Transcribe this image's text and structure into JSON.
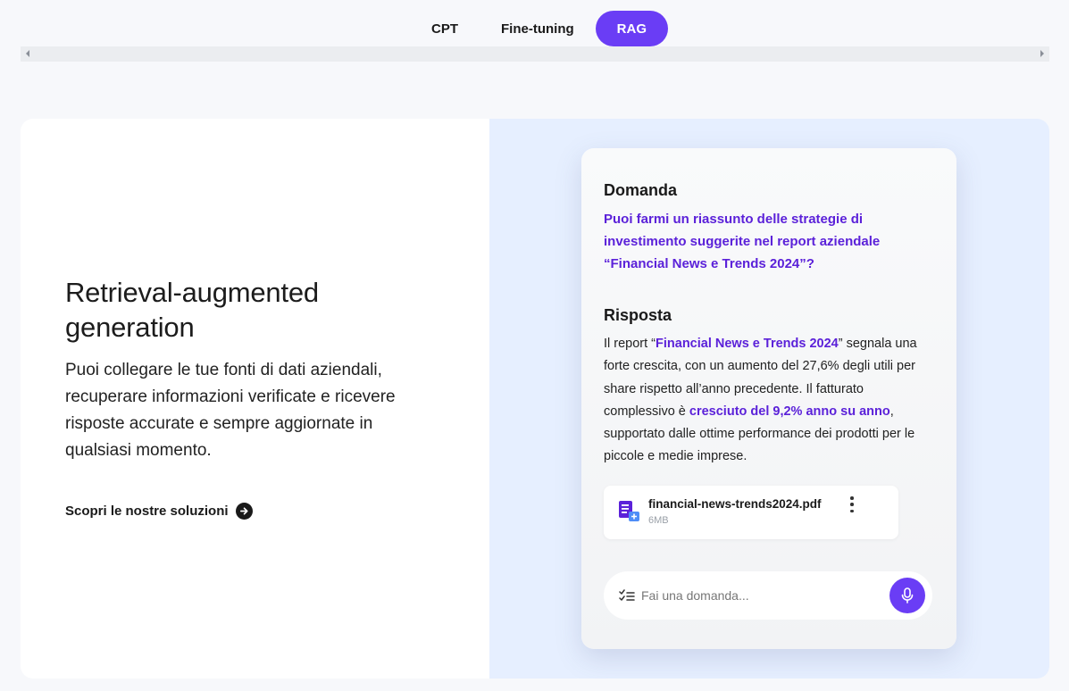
{
  "tabs": [
    {
      "label": "CPT",
      "active": false
    },
    {
      "label": "Fine-tuning",
      "active": false
    },
    {
      "label": "RAG",
      "active": true
    }
  ],
  "left": {
    "title": "Retrieval-augmented generation",
    "description": "Puoi collegare le tue fonti di dati aziendali, recuperare informazioni verificate e ricevere risposte accurate e sempre aggiornate in qualsiasi momento.",
    "cta_label": "Scopri le nostre soluzioni",
    "cta_icon": "arrow-right-circle-icon"
  },
  "panel": {
    "question_label": "Domanda",
    "question_text": "Puoi farmi un riassunto delle strategie di investimento suggerite nel report aziendale “Financial News e Trends 2024”?",
    "answer_label": "Risposta",
    "answer_parts": [
      "Il report “",
      "Financial News e Trends 2024",
      "” segnala una forte crescita, con un aumento del 27,6% degli utili per share rispetto all’anno precedente. Il fatturato complessivo è ",
      "cresciuto del 9,2% anno su anno",
      ", supportato dalle ottime performance dei prodotti per le piccole e medie imprese."
    ],
    "file": {
      "name": "financial-news-trends2024.pdf",
      "size": "6MB",
      "icon": "document-icon"
    },
    "input": {
      "placeholder": "Fai una domanda...",
      "value": ""
    },
    "mic_icon": "microphone-icon"
  },
  "colors": {
    "accent": "#6a3df5",
    "highlight_text": "#5b21d9",
    "right_panel_bg": "#e6efff",
    "page_bg": "#f7f8fb"
  }
}
